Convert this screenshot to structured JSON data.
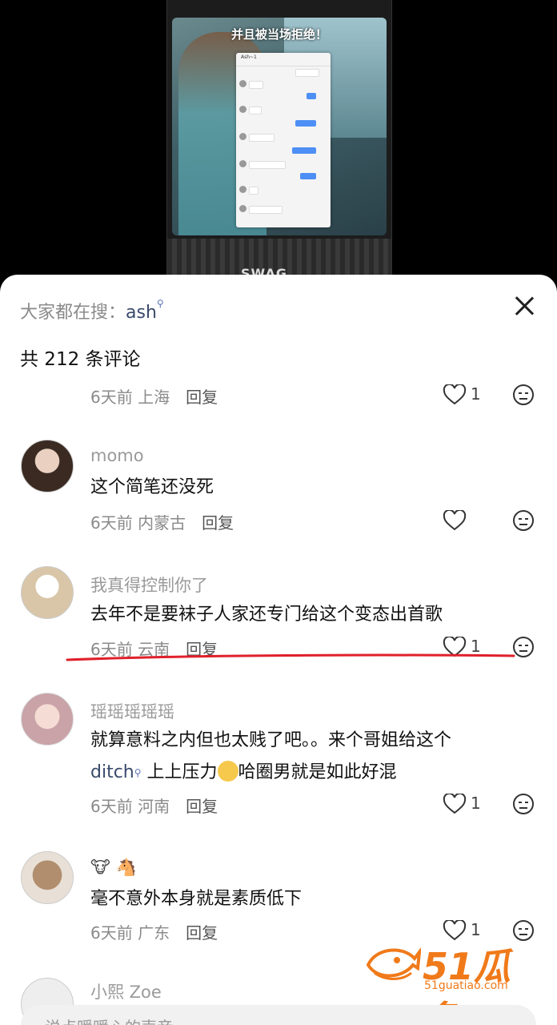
{
  "video": {
    "caption": "并且被当场拒绝！",
    "chat_contact": "Ash~1",
    "bottom_text": "SWAG"
  },
  "sheet": {
    "search_prefix": "大家都在搜：",
    "search_keyword": "ash",
    "comment_count": "共 212 条评论",
    "reply_label": "回复"
  },
  "comments": [
    {
      "user": "",
      "text": "",
      "time": "6天前",
      "location": "上海",
      "likes": "1"
    },
    {
      "user": "momo",
      "text": "这个简笔还没死",
      "time": "6天前",
      "location": "内蒙古",
      "likes": ""
    },
    {
      "user": "我真得控制你了",
      "text": "去年不是要袜子人家还专门给这个变态出首歌",
      "time": "6天前",
      "location": "云南",
      "likes": "1"
    },
    {
      "user": "瑶瑶瑶瑶瑶",
      "text_line1": "就算意料之内但也太贱了吧。。来个哥姐给这个",
      "link": "ditch",
      "text_line2_a": " 上上压力",
      "text_line2_b": "哈圈男就是如此好混",
      "time": "6天前",
      "location": "河南",
      "likes": "1"
    },
    {
      "user": "🐮 🐴",
      "text": "毫不意外本身就是素质低下",
      "time": "6天前",
      "location": "广东",
      "likes": "1"
    },
    {
      "user": "小熙 Zoe",
      "text": "",
      "time": "",
      "location": "",
      "likes": ""
    }
  ],
  "input": {
    "placeholder": "说点暖暖心的声音"
  },
  "watermark": {
    "brand": "51瓜条",
    "url": "51guatiao.com"
  },
  "colors": {
    "accent_link": "#3a4a6b",
    "underline": "#e0202b",
    "watermark": "#f07a1a"
  }
}
